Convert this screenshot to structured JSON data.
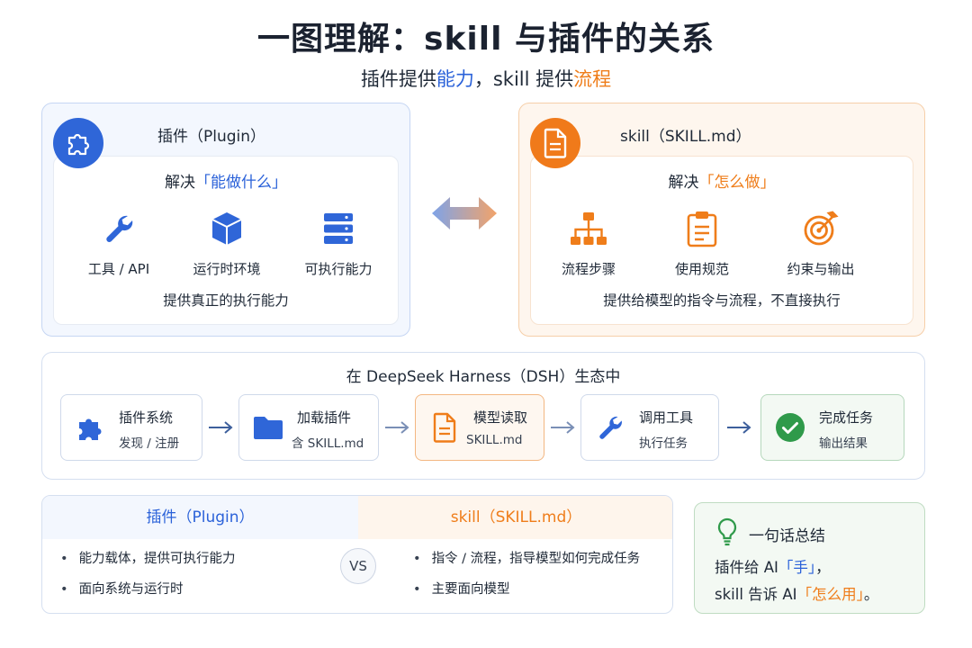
{
  "title": "一图理解：skill 与插件的关系",
  "subtitle": {
    "pre": "插件提供",
    "ability": "能力",
    "mid": "，skill 提供",
    "process": "流程"
  },
  "plugin_panel": {
    "heading": "插件（Plugin）",
    "solve_pre": "解决",
    "solve_key": "「能做什么」",
    "features": [
      {
        "label": "工具 / API",
        "icon": "wrench-icon"
      },
      {
        "label": "运行时环境",
        "icon": "cube-icon"
      },
      {
        "label": "可执行能力",
        "icon": "server-stack-icon"
      }
    ],
    "footer": "提供真正的执行能力"
  },
  "skill_panel": {
    "heading": "skill（SKILL.md）",
    "solve_pre": "解决",
    "solve_key": "「怎么做」",
    "features": [
      {
        "label": "流程步骤",
        "icon": "flowchart-icon"
      },
      {
        "label": "使用规范",
        "icon": "clipboard-icon"
      },
      {
        "label": "约束与输出",
        "icon": "target-icon"
      }
    ],
    "footer": "提供给模型的指令与流程，不直接执行"
  },
  "flow": {
    "title": "在 DeepSeek Harness（DSH）生态中",
    "steps": [
      {
        "title": "插件系统",
        "sub": "发现 / 注册",
        "icon": "puzzle-icon"
      },
      {
        "title": "加载插件",
        "sub": "含 SKILL.md",
        "icon": "folder-icon"
      },
      {
        "title": "模型读取",
        "sub": "SKILL.md",
        "icon": "document-icon"
      },
      {
        "title": "调用工具",
        "sub": "执行任务",
        "icon": "wrench-icon"
      },
      {
        "title": "完成任务",
        "sub": "输出结果",
        "icon": "check-circle-icon"
      }
    ]
  },
  "compare": {
    "left_title": "插件（Plugin）",
    "right_title": "skill（SKILL.md）",
    "vs": "VS",
    "left_items": [
      "能力载体，提供可执行能力",
      "面向系统与运行时"
    ],
    "right_items": [
      "指令 / 流程，指导模型如何完成任务",
      "主要面向模型"
    ]
  },
  "summary": {
    "heading": "一句话总结",
    "line1_pre": "插件给 AI",
    "line1_key": "「手」",
    "line1_post": "，",
    "line2_pre": "skill 告诉 AI",
    "line2_key": "「怎么用」",
    "line2_post": "。"
  },
  "colors": {
    "blue": "#2b62d9",
    "orange": "#ef7d1a",
    "green": "#2f9a4a"
  }
}
